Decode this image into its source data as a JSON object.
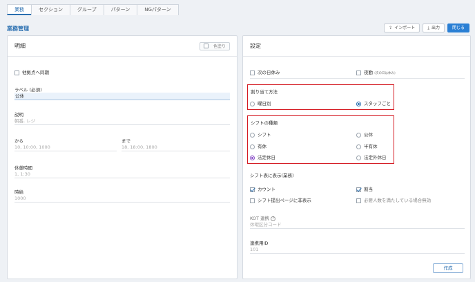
{
  "tabs": [
    {
      "label": "業務"
    },
    {
      "label": "セクション"
    },
    {
      "label": "グループ"
    },
    {
      "label": "パターン"
    },
    {
      "label": "NGパターン"
    }
  ],
  "page": {
    "title": "業務管理"
  },
  "toolbar": {
    "import_label": "インポート",
    "export_label": "出力",
    "close_label": "閉じる"
  },
  "left": {
    "title": "明細",
    "color_button": "色塗り",
    "sync_label": "他拠点へ同期",
    "label_field": {
      "label": "ラベル (必須)",
      "value": "公休"
    },
    "description": {
      "label": "説明",
      "placeholder": "朝番, レジ"
    },
    "from": {
      "label": "から",
      "placeholder": "10, 10:00, 1000"
    },
    "to": {
      "label": "まで",
      "placeholder": "18, 18:00, 1800"
    },
    "break": {
      "label": "休憩時間",
      "placeholder": "1, 1:30"
    },
    "wage": {
      "label": "時給",
      "placeholder": "1000"
    }
  },
  "right": {
    "title": "設定",
    "next_day_off": "次の日休み",
    "night": {
      "label": "夜勤",
      "note": "(次の日は休み)"
    },
    "assign_method": {
      "label": "割り当て方法",
      "options": [
        "曜日別",
        "スタッフごと"
      ]
    },
    "shift_type": {
      "label": "シフトの種類",
      "options": [
        "シフト",
        "公休",
        "有休",
        "半有休",
        "法定休日",
        "法定外休日"
      ]
    },
    "shift_display": {
      "label": "シフト表に表示(業務)",
      "count": "カウント",
      "assign": "割当",
      "hide_submit": "シフト提出ページに非表示",
      "auto_assign": "必要人数を満たしている場合無効"
    },
    "kot": {
      "label": "KOT 連携",
      "placeholder": "休暇区分コード"
    },
    "link_id": {
      "label": "連携用ID",
      "placeholder": "101"
    },
    "create_label": "作成"
  }
}
